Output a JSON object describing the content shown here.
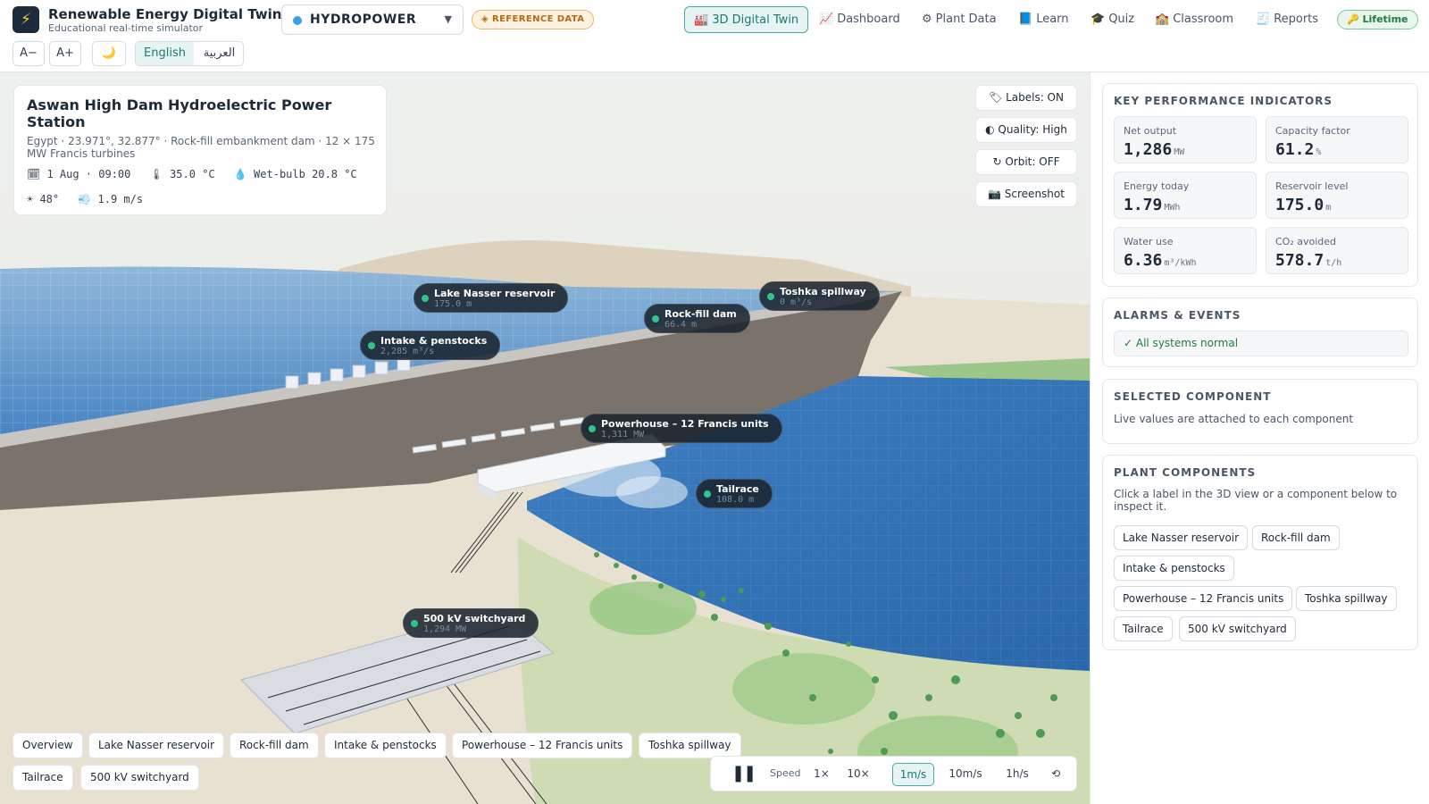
{
  "header": {
    "app_title": "Renewable Energy Digital Twin",
    "app_subtitle": "Educational real-time simulator",
    "plant_type": "HYDROPOWER",
    "reference_badge": "◈ REFERENCE DATA",
    "nav": [
      {
        "icon": "🏭",
        "icon_name": "factory-icon",
        "label": "3D Digital Twin",
        "active": true
      },
      {
        "icon": "📈",
        "icon_name": "chart-icon",
        "label": "Dashboard"
      },
      {
        "icon": "⚙",
        "icon_name": "gear-icon",
        "label": "Plant Data"
      },
      {
        "icon": "📘",
        "icon_name": "book-icon",
        "label": "Learn"
      },
      {
        "icon": "🎓",
        "icon_name": "graduation-cap-icon",
        "label": "Quiz"
      },
      {
        "icon": "🏫",
        "icon_name": "school-icon",
        "label": "Classroom"
      },
      {
        "icon": "🧾",
        "icon_name": "receipt-icon",
        "label": "Reports"
      }
    ],
    "license_badge": "🔑 Lifetime",
    "font_decrease": "A−",
    "font_increase": "A+",
    "theme_toggle": "🌙",
    "lang_en": "English",
    "lang_ar": "العربية"
  },
  "site": {
    "title": "Aswan High Dam Hydroelectric Power Station",
    "subtitle": "Egypt · 23.971°, 32.877° · Rock-fill embankment dam · 12 × 175 MW Francis turbines",
    "date": "🗓 1 Aug · 09:00",
    "temp": "🌡 35.0 °C",
    "wetbulb": "💧 Wet-bulb 20.8 °C",
    "sun": "☀ 48°",
    "wind": "💨 1.9 m/s"
  },
  "view_controls": {
    "labels": "🏷 Labels: ON",
    "quality": "◐ Quality: High",
    "orbit": "↻ Orbit: OFF",
    "screenshot": "📷 Screenshot"
  },
  "scene_labels": [
    {
      "name": "Lake Nasser reservoir",
      "value": "175.0 m"
    },
    {
      "name": "Rock-fill dam",
      "value": "66.4 m"
    },
    {
      "name": "Toshka spillway",
      "value": "0 m³/s"
    },
    {
      "name": "Intake & penstocks",
      "value": "2,285 m³/s"
    },
    {
      "name": "Powerhouse – 12 Francis units",
      "value": "1,311 MW"
    },
    {
      "name": "Tailrace",
      "value": "108.0 m"
    },
    {
      "name": "500 kV switchyard",
      "value": "1,294 MW"
    }
  ],
  "view_chips": [
    "Overview",
    "Lake Nasser reservoir",
    "Rock-fill dam",
    "Intake & penstocks",
    "Powerhouse – 12 Francis units",
    "Toshka spillway",
    "Tailrace",
    "500 kV switchyard"
  ],
  "speed": {
    "pause": "❚❚",
    "label": "Speed",
    "options": [
      "1×",
      "10×",
      "1m/s",
      "10m/s",
      "1h/s"
    ],
    "active": "1m/s",
    "reset": "⟲"
  },
  "kpis": {
    "title": "KEY PERFORMANCE INDICATORS",
    "items": [
      {
        "label": "Net output",
        "value": "1,286",
        "unit": "MW"
      },
      {
        "label": "Capacity factor",
        "value": "61.2",
        "unit": "%"
      },
      {
        "label": "Energy today",
        "value": "1.79",
        "unit": "MWh"
      },
      {
        "label": "Reservoir level",
        "value": "175.0",
        "unit": "m"
      },
      {
        "label": "Water use",
        "value": "6.36",
        "unit": "m³/kWh"
      },
      {
        "label": "CO₂ avoided",
        "value": "578.7",
        "unit": "t/h"
      }
    ]
  },
  "alarms": {
    "title": "ALARMS & EVENTS",
    "status": "✓ All systems normal"
  },
  "selected": {
    "title": "SELECTED COMPONENT",
    "text": "Live values are attached to each component"
  },
  "components": {
    "title": "PLANT COMPONENTS",
    "text": "Click a label in the 3D view or a component below to inspect it.",
    "items": [
      "Lake Nasser reservoir",
      "Rock-fill dam",
      "Intake & penstocks",
      "Powerhouse – 12 Francis units",
      "Toshka spillway",
      "Tailrace",
      "500 kV switchyard"
    ]
  },
  "colors": {
    "accent": "#1b7a73",
    "reservoir": "#3b78b6",
    "dam": "#7a726b",
    "ok": "#1f7a43"
  }
}
